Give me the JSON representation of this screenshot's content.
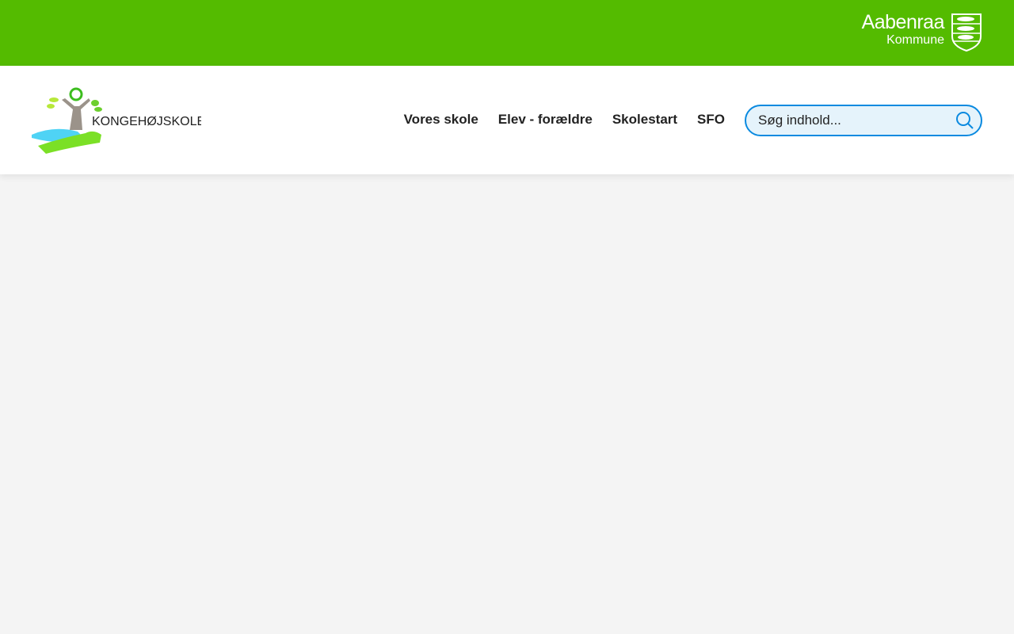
{
  "topbar": {
    "municipality_line1": "Aabenraa",
    "municipality_line2": "Kommune",
    "color": "#54bb00"
  },
  "logo": {
    "text": "KONGEHØJSKOLEN"
  },
  "nav": {
    "items": [
      {
        "label": "Vores skole"
      },
      {
        "label": "Elev - forældre"
      },
      {
        "label": "Skolestart"
      },
      {
        "label": "SFO"
      }
    ]
  },
  "search": {
    "placeholder": "Søg indhold...",
    "value": "",
    "icon": "search-icon"
  }
}
